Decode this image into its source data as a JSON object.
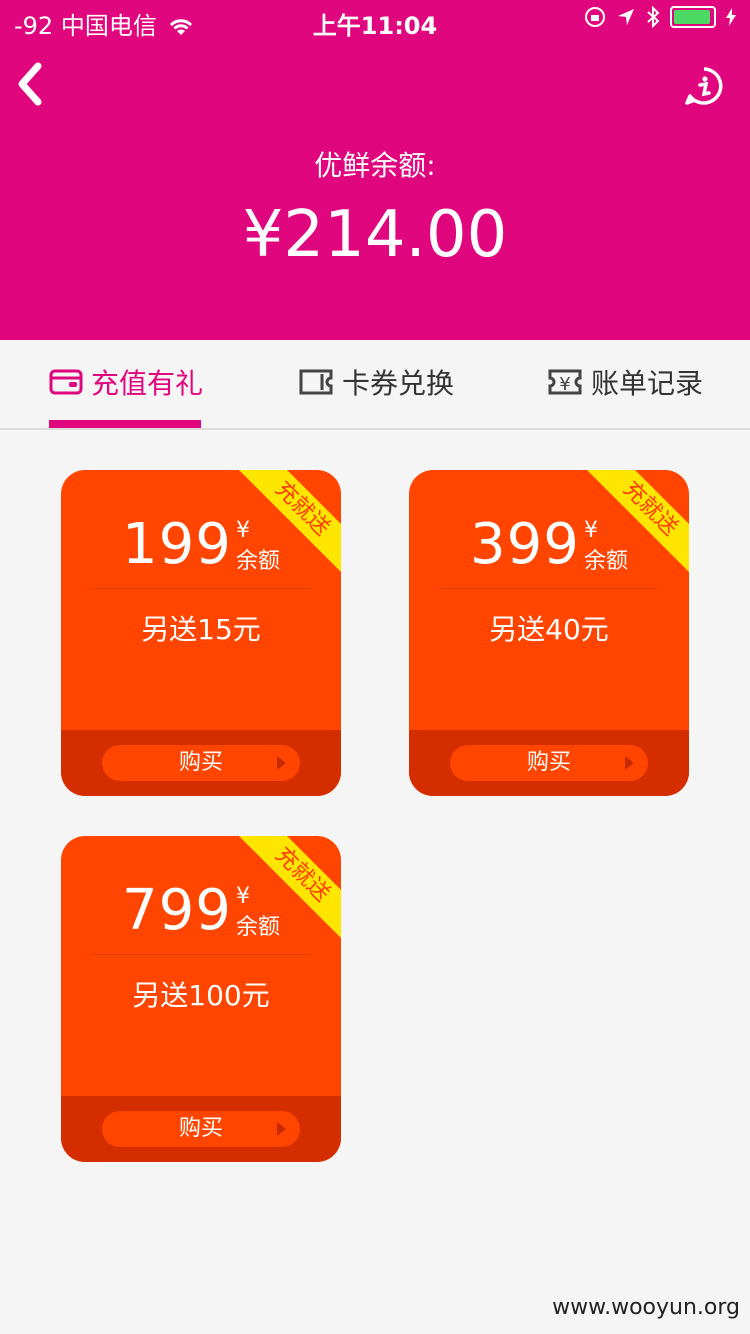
{
  "status_bar": {
    "signal": "-92",
    "carrier": "中国电信",
    "time": "上午11:04"
  },
  "header": {
    "balance_label": "优鲜余额:",
    "balance_value": "¥214.00",
    "back_icon": "chevron-left-icon",
    "info_icon": "info-icon"
  },
  "tabs": [
    {
      "label": "充值有礼",
      "icon": "wallet-icon",
      "active": true
    },
    {
      "label": "卡券兑换",
      "icon": "ticket-icon",
      "active": false
    },
    {
      "label": "账单记录",
      "icon": "bill-icon",
      "active": false
    }
  ],
  "cards": [
    {
      "amount": "199",
      "yen": "¥",
      "unit": "余额",
      "bonus": "另送15元",
      "ribbon": "充就送",
      "buy_label": "购买"
    },
    {
      "amount": "399",
      "yen": "¥",
      "unit": "余额",
      "bonus": "另送40元",
      "ribbon": "充就送",
      "buy_label": "购买"
    },
    {
      "amount": "799",
      "yen": "¥",
      "unit": "余额",
      "bonus": "另送100元",
      "ribbon": "充就送",
      "buy_label": "购买"
    }
  ],
  "watermark": "www.wooyun.org",
  "colors": {
    "brand": "#e0067e",
    "card": "#ff4500",
    "card_footer": "#d42e00",
    "ribbon": "#ffe600"
  }
}
